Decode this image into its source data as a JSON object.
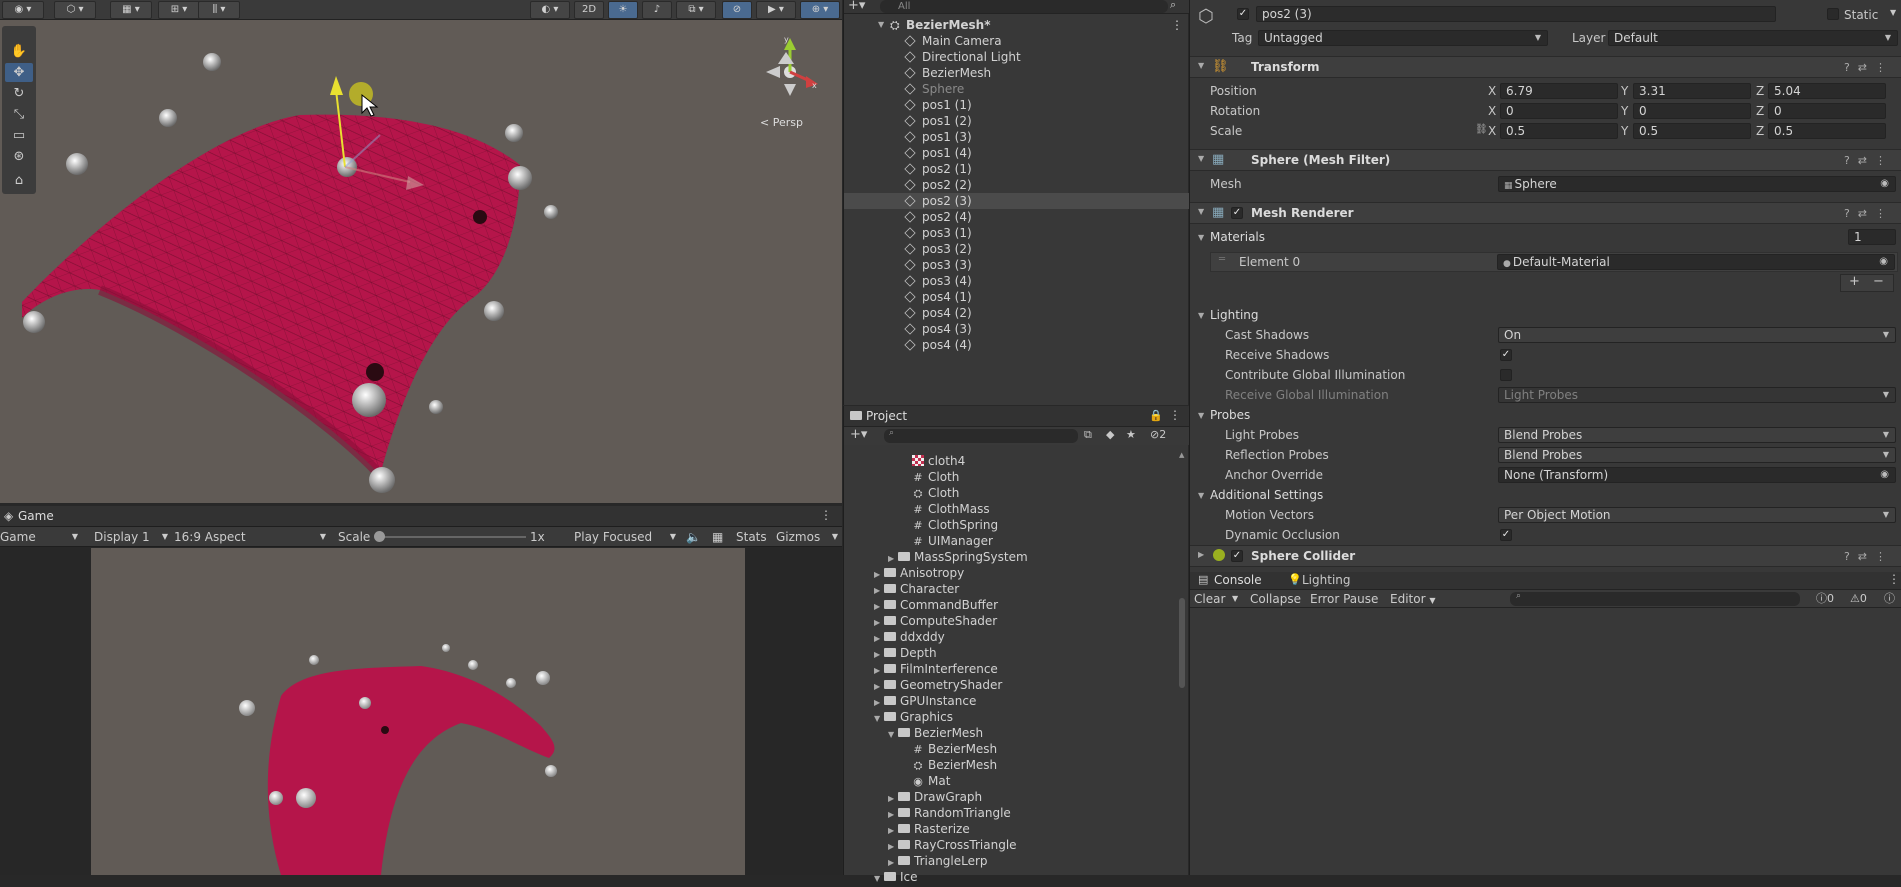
{
  "scene": {
    "toolbar": {
      "btn_2d": "2D"
    },
    "persp_label": "< Persp"
  },
  "game": {
    "tab_label": "Game",
    "display_mode": "Game",
    "display": "Display 1",
    "aspect": "16:9 Aspect",
    "scale_label": "Scale",
    "scale_value": "1x",
    "play_mode": "Play Focused",
    "stats": "Stats",
    "gizmos": "Gizmos"
  },
  "hierarchy": {
    "search_placeholder": "All",
    "root": "BezierMesh*",
    "items": [
      {
        "label": "Main Camera"
      },
      {
        "label": "Directional Light"
      },
      {
        "label": "BezierMesh"
      },
      {
        "label": "Sphere",
        "dim": true
      },
      {
        "label": "pos1 (1)"
      },
      {
        "label": "pos1 (2)"
      },
      {
        "label": "pos1 (3)"
      },
      {
        "label": "pos1 (4)"
      },
      {
        "label": "pos2 (1)"
      },
      {
        "label": "pos2 (2)"
      },
      {
        "label": "pos2 (3)",
        "selected": true
      },
      {
        "label": "pos2 (4)"
      },
      {
        "label": "pos3 (1)"
      },
      {
        "label": "pos3 (2)"
      },
      {
        "label": "pos3 (3)"
      },
      {
        "label": "pos3 (4)"
      },
      {
        "label": "pos4 (1)"
      },
      {
        "label": "pos4 (2)"
      },
      {
        "label": "pos4 (3)"
      },
      {
        "label": "pos4 (4)"
      }
    ]
  },
  "project": {
    "tab_label": "Project",
    "hidden_count": "2",
    "items": [
      {
        "label": "cloth4",
        "icon": "texture-icon",
        "indent": 3
      },
      {
        "label": "Cloth",
        "icon": "script-icon",
        "indent": 3
      },
      {
        "label": "Cloth",
        "icon": "shader-icon",
        "indent": 3
      },
      {
        "label": "ClothMass",
        "icon": "script-icon",
        "indent": 3
      },
      {
        "label": "ClothSpring",
        "icon": "script-icon",
        "indent": 3
      },
      {
        "label": "UIManager",
        "icon": "script-icon",
        "indent": 3
      },
      {
        "label": "MassSpringSystem",
        "icon": "folder-icon",
        "indent": 2,
        "arrow": "right"
      },
      {
        "label": "Anisotropy",
        "icon": "folder-icon",
        "indent": 1,
        "arrow": "right"
      },
      {
        "label": "Character",
        "icon": "folder-icon",
        "indent": 1,
        "arrow": "right"
      },
      {
        "label": "CommandBuffer",
        "icon": "folder-icon",
        "indent": 1,
        "arrow": "right"
      },
      {
        "label": "ComputeShader",
        "icon": "folder-icon",
        "indent": 1,
        "arrow": "right"
      },
      {
        "label": "ddxddy",
        "icon": "folder-icon",
        "indent": 1,
        "arrow": "right"
      },
      {
        "label": "Depth",
        "icon": "folder-icon",
        "indent": 1,
        "arrow": "right"
      },
      {
        "label": "FilmInterference",
        "icon": "folder-icon",
        "indent": 1,
        "arrow": "right"
      },
      {
        "label": "GeometryShader",
        "icon": "folder-icon",
        "indent": 1,
        "arrow": "right"
      },
      {
        "label": "GPUInstance",
        "icon": "folder-icon",
        "indent": 1,
        "arrow": "right"
      },
      {
        "label": "Graphics",
        "icon": "folder-open-icon",
        "indent": 1,
        "arrow": "down"
      },
      {
        "label": "BezierMesh",
        "icon": "folder-open-icon",
        "indent": 2,
        "arrow": "down"
      },
      {
        "label": "BezierMesh",
        "icon": "script-icon",
        "indent": 3
      },
      {
        "label": "BezierMesh",
        "icon": "shader-icon",
        "indent": 3
      },
      {
        "label": "Mat",
        "icon": "material-icon",
        "indent": 3
      },
      {
        "label": "DrawGraph",
        "icon": "folder-icon",
        "indent": 2,
        "arrow": "right"
      },
      {
        "label": "RandomTriangle",
        "icon": "folder-icon",
        "indent": 2,
        "arrow": "right"
      },
      {
        "label": "Rasterize",
        "icon": "folder-icon",
        "indent": 2,
        "arrow": "right"
      },
      {
        "label": "RayCrossTriangle",
        "icon": "folder-icon",
        "indent": 2,
        "arrow": "right"
      },
      {
        "label": "TriangleLerp",
        "icon": "folder-icon",
        "indent": 2,
        "arrow": "right"
      },
      {
        "label": "Ice",
        "icon": "folder-open-icon",
        "indent": 1,
        "arrow": "down"
      }
    ]
  },
  "inspector": {
    "object_name": "pos2 (3)",
    "static_label": "Static",
    "tag_label": "Tag",
    "tag_value": "Untagged",
    "layer_label": "Layer",
    "layer_value": "Default",
    "transform": {
      "title": "Transform",
      "position_label": "Position",
      "rotation_label": "Rotation",
      "scale_label": "Scale",
      "axis_x": "X",
      "axis_y": "Y",
      "axis_z": "Z",
      "position": [
        "6.79",
        "3.31",
        "5.04"
      ],
      "rotation": [
        "0",
        "0",
        "0"
      ],
      "scale": [
        "0.5",
        "0.5",
        "0.5"
      ]
    },
    "mesh_filter": {
      "title": "Sphere (Mesh Filter)",
      "mesh_label": "Mesh",
      "mesh_value": "Sphere"
    },
    "mesh_renderer": {
      "title": "Mesh Renderer",
      "materials_label": "Materials",
      "materials_count": "1",
      "element_label": "Element 0",
      "element_value": "Default-Material",
      "lighting_label": "Lighting",
      "cast_shadows_label": "Cast Shadows",
      "cast_shadows_value": "On",
      "receive_shadows_label": "Receive Shadows",
      "contribute_gi_label": "Contribute Global Illumination",
      "receive_gi_label": "Receive Global Illumination",
      "receive_gi_value": "Light Probes",
      "probes_label": "Probes",
      "light_probes_label": "Light Probes",
      "light_probes_value": "Blend Probes",
      "reflection_probes_label": "Reflection Probes",
      "reflection_probes_value": "Blend Probes",
      "anchor_override_label": "Anchor Override",
      "anchor_override_value": "None (Transform)",
      "additional_settings_label": "Additional Settings",
      "motion_vectors_label": "Motion Vectors",
      "motion_vectors_value": "Per Object Motion",
      "dynamic_occlusion_label": "Dynamic Occlusion"
    },
    "sphere_collider": {
      "title": "Sphere Collider"
    }
  },
  "console": {
    "tab_console": "Console",
    "tab_lighting": "Lighting",
    "clear": "Clear",
    "collapse": "Collapse",
    "error_pause": "Error Pause",
    "editor": "Editor",
    "count_info": "0",
    "count_warn": "0"
  },
  "colors": {
    "mesh": "#b5154a",
    "selection": "#4b4b4b",
    "accent": "#3f5f87",
    "scene_bg": "#615b56"
  }
}
